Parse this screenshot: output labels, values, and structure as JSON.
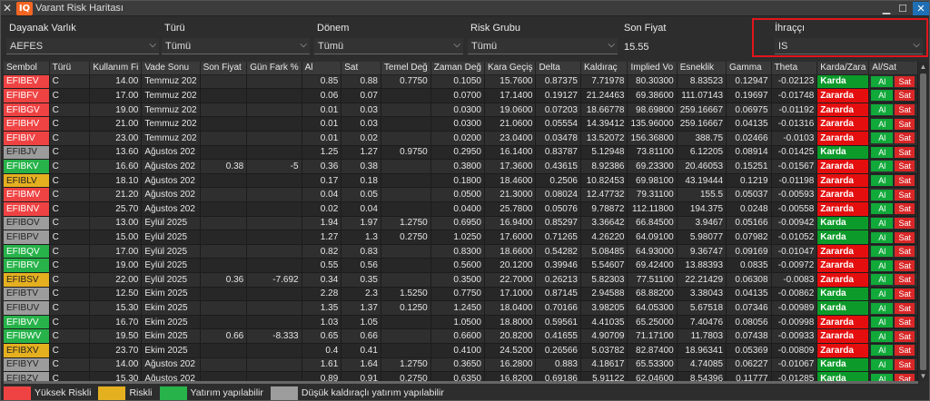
{
  "window": {
    "title": "Varant Risk Haritası",
    "logo": "IQ"
  },
  "filters": {
    "dayanak": {
      "label": "Dayanak Varlık",
      "value": "AEFES"
    },
    "turu": {
      "label": "Türü",
      "value": "Tümü"
    },
    "donem": {
      "label": "Dönem",
      "value": "Tümü"
    },
    "risk": {
      "label": "Risk Grubu",
      "value": "Tümü"
    },
    "sonfiyat": {
      "label": "Son Fiyat",
      "value": "15.55"
    },
    "ihracci": {
      "label": "İhraççı",
      "value": "IS"
    }
  },
  "columns": [
    "Sembol",
    "Türü",
    "Kullanım Fi",
    "Vade Sonu",
    "Son Fiyat",
    "Gün Fark %",
    "Al",
    "Sat",
    "Temel Değ",
    "Zaman Değ",
    "Kara Geçiş",
    "Delta",
    "Kaldıraç",
    "Implied Vo",
    "Esneklik",
    "Gamma",
    "Theta",
    "Karda/Zara",
    "Al/Sat"
  ],
  "buttons": {
    "al": "Al",
    "sat": "Sat"
  },
  "rows": [
    {
      "sym": "EFIBEV",
      "risk": "red",
      "t": "C",
      "k": "14.00",
      "v": "Temmuz 202",
      "sf": "",
      "gf": "",
      "al": "0.85",
      "sat": "0.88",
      "td": "0.7750",
      "zd": "0.1050",
      "kg": "15.7600",
      "d": "0.87375",
      "kl": "7.71978",
      "iv": "80.30300",
      "e": "8.83523",
      "g": "0.12947",
      "th": "-0.02123",
      "st": "Karda"
    },
    {
      "sym": "EFIBFV",
      "risk": "red",
      "t": "C",
      "k": "17.00",
      "v": "Temmuz 202",
      "sf": "",
      "gf": "",
      "al": "0.06",
      "sat": "0.07",
      "td": "",
      "zd": "0.0700",
      "kg": "17.1400",
      "d": "0.19127",
      "kl": "21.24463",
      "iv": "69.38600",
      "e": "111.07143",
      "g": "0.19697",
      "th": "-0.01748",
      "st": "Zararda"
    },
    {
      "sym": "EFIBGV",
      "risk": "red",
      "t": "C",
      "k": "19.00",
      "v": "Temmuz 202",
      "sf": "",
      "gf": "",
      "al": "0.01",
      "sat": "0.03",
      "td": "",
      "zd": "0.0300",
      "kg": "19.0600",
      "d": "0.07203",
      "kl": "18.66778",
      "iv": "98.69800",
      "e": "259.16667",
      "g": "0.06975",
      "th": "-0.01192",
      "st": "Zararda"
    },
    {
      "sym": "EFIBHV",
      "risk": "red",
      "t": "C",
      "k": "21.00",
      "v": "Temmuz 202",
      "sf": "",
      "gf": "",
      "al": "0.01",
      "sat": "0.03",
      "td": "",
      "zd": "0.0300",
      "kg": "21.0600",
      "d": "0.05554",
      "kl": "14.39412",
      "iv": "135.96000",
      "e": "259.16667",
      "g": "0.04135",
      "th": "-0.01316",
      "st": "Zararda"
    },
    {
      "sym": "EFIBIV",
      "risk": "red",
      "t": "C",
      "k": "23.00",
      "v": "Temmuz 202",
      "sf": "",
      "gf": "",
      "al": "0.01",
      "sat": "0.02",
      "td": "",
      "zd": "0.0200",
      "kg": "23.0400",
      "d": "0.03478",
      "kl": "13.52072",
      "iv": "156.36800",
      "e": "388.75",
      "g": "0.02466",
      "th": "-0.0103",
      "st": "Zararda"
    },
    {
      "sym": "EFIBJV",
      "risk": "gray",
      "t": "C",
      "k": "13.60",
      "v": "Ağustos 202",
      "sf": "",
      "gf": "",
      "al": "1.25",
      "sat": "1.27",
      "td": "0.9750",
      "zd": "0.2950",
      "kg": "16.1400",
      "d": "0.83787",
      "kl": "5.12948",
      "iv": "73.81100",
      "e": "6.12205",
      "g": "0.08914",
      "th": "-0.01425",
      "st": "Karda"
    },
    {
      "sym": "EFIBKV",
      "risk": "green",
      "t": "C",
      "k": "16.60",
      "v": "Ağustos 202",
      "sf": "0.38",
      "gf": "-5",
      "al": "0.36",
      "sat": "0.38",
      "td": "",
      "zd": "0.3800",
      "kg": "17.3600",
      "d": "0.43615",
      "kl": "8.92386",
      "iv": "69.23300",
      "e": "20.46053",
      "g": "0.15251",
      "th": "-0.01567",
      "st": "Zararda"
    },
    {
      "sym": "EFIBLV",
      "risk": "yellow",
      "t": "C",
      "k": "18.10",
      "v": "Ağustos 202",
      "sf": "",
      "gf": "",
      "al": "0.17",
      "sat": "0.18",
      "td": "",
      "zd": "0.1800",
      "kg": "18.4600",
      "d": "0.2506",
      "kl": "10.82453",
      "iv": "69.98100",
      "e": "43.19444",
      "g": "0.1219",
      "th": "-0.01198",
      "st": "Zararda"
    },
    {
      "sym": "EFIBMV",
      "risk": "red",
      "t": "C",
      "k": "21.20",
      "v": "Ağustos 202",
      "sf": "",
      "gf": "",
      "al": "0.04",
      "sat": "0.05",
      "td": "",
      "zd": "0.0500",
      "kg": "21.3000",
      "d": "0.08024",
      "kl": "12.47732",
      "iv": "79.31100",
      "e": "155.5",
      "g": "0.05037",
      "th": "-0.00593",
      "st": "Zararda"
    },
    {
      "sym": "EFIBNV",
      "risk": "red",
      "t": "C",
      "k": "25.70",
      "v": "Ağustos 202",
      "sf": "",
      "gf": "",
      "al": "0.02",
      "sat": "0.04",
      "td": "",
      "zd": "0.0400",
      "kg": "25.7800",
      "d": "0.05076",
      "kl": "9.78872",
      "iv": "112.11800",
      "e": "194.375",
      "g": "0.0248",
      "th": "-0.00558",
      "st": "Zararda"
    },
    {
      "sym": "EFIBOV",
      "risk": "gray",
      "t": "C",
      "k": "13.00",
      "v": "Eylül 2025",
      "sf": "",
      "gf": "",
      "al": "1.94",
      "sat": "1.97",
      "td": "1.2750",
      "zd": "0.6950",
      "kg": "16.9400",
      "d": "0.85297",
      "kl": "3.36642",
      "iv": "66.84500",
      "e": "3.9467",
      "g": "0.05166",
      "th": "-0.00942",
      "st": "Karda"
    },
    {
      "sym": "EFIBPV",
      "risk": "gray",
      "t": "C",
      "k": "15.00",
      "v": "Eylül 2025",
      "sf": "",
      "gf": "",
      "al": "1.27",
      "sat": "1.3",
      "td": "0.2750",
      "zd": "1.0250",
      "kg": "17.6000",
      "d": "0.71265",
      "kl": "4.26220",
      "iv": "64.09100",
      "e": "5.98077",
      "g": "0.07982",
      "th": "-0.01052",
      "st": "Karda"
    },
    {
      "sym": "EFIBQV",
      "risk": "green",
      "t": "C",
      "k": "17.00",
      "v": "Eylül 2025",
      "sf": "",
      "gf": "",
      "al": "0.82",
      "sat": "0.83",
      "td": "",
      "zd": "0.8300",
      "kg": "18.6600",
      "d": "0.54282",
      "kl": "5.08485",
      "iv": "64.93000",
      "e": "9.36747",
      "g": "0.09169",
      "th": "-0.01047",
      "st": "Zararda"
    },
    {
      "sym": "EFIBRV",
      "risk": "green",
      "t": "C",
      "k": "19.00",
      "v": "Eylül 2025",
      "sf": "",
      "gf": "",
      "al": "0.55",
      "sat": "0.56",
      "td": "",
      "zd": "0.5600",
      "kg": "20.1200",
      "d": "0.39946",
      "kl": "5.54607",
      "iv": "69.42400",
      "e": "13.88393",
      "g": "0.0835",
      "th": "-0.00972",
      "st": "Zararda"
    },
    {
      "sym": "EFIBSV",
      "risk": "yellow",
      "t": "C",
      "k": "22.00",
      "v": "Eylül 2025",
      "sf": "0.36",
      "gf": "-7.692",
      "al": "0.34",
      "sat": "0.35",
      "td": "",
      "zd": "0.3500",
      "kg": "22.7000",
      "d": "0.26213",
      "kl": "5.82303",
      "iv": "77.51100",
      "e": "22.21429",
      "g": "0.06308",
      "th": "-0.0083",
      "st": "Zararda"
    },
    {
      "sym": "EFIBTV",
      "risk": "gray",
      "t": "C",
      "k": "12.50",
      "v": "Ekim 2025",
      "sf": "",
      "gf": "",
      "al": "2.28",
      "sat": "2.3",
      "td": "1.5250",
      "zd": "0.7750",
      "kg": "17.1000",
      "d": "0.87145",
      "kl": "2.94588",
      "iv": "68.88200",
      "e": "3.38043",
      "g": "0.04135",
      "th": "-0.00862",
      "st": "Karda"
    },
    {
      "sym": "EFIBUV",
      "risk": "gray",
      "t": "C",
      "k": "15.30",
      "v": "Ekim 2025",
      "sf": "",
      "gf": "",
      "al": "1.35",
      "sat": "1.37",
      "td": "0.1250",
      "zd": "1.2450",
      "kg": "18.0400",
      "d": "0.70166",
      "kl": "3.98205",
      "iv": "64.05300",
      "e": "5.67518",
      "g": "0.07346",
      "th": "-0.00989",
      "st": "Karda"
    },
    {
      "sym": "EFIBVV",
      "risk": "green",
      "t": "C",
      "k": "16.70",
      "v": "Ekim 2025",
      "sf": "",
      "gf": "",
      "al": "1.03",
      "sat": "1.05",
      "td": "",
      "zd": "1.0500",
      "kg": "18.8000",
      "d": "0.59561",
      "kl": "4.41035",
      "iv": "65.25000",
      "e": "7.40476",
      "g": "0.08056",
      "th": "-0.00998",
      "st": "Zararda"
    },
    {
      "sym": "EFIBWV",
      "risk": "green",
      "t": "C",
      "k": "19.50",
      "v": "Ekim 2025",
      "sf": "0.66",
      "gf": "-8.333",
      "al": "0.65",
      "sat": "0.66",
      "td": "",
      "zd": "0.6600",
      "kg": "20.8200",
      "d": "0.41655",
      "kl": "4.90709",
      "iv": "71.17100",
      "e": "11.7803",
      "g": "0.07438",
      "th": "-0.00933",
      "st": "Zararda"
    },
    {
      "sym": "EFIBXV",
      "risk": "yellow",
      "t": "C",
      "k": "23.70",
      "v": "Ekim 2025",
      "sf": "",
      "gf": "",
      "al": "0.4",
      "sat": "0.41",
      "td": "",
      "zd": "0.4100",
      "kg": "24.5200",
      "d": "0.26566",
      "kl": "5.03782",
      "iv": "82.87400",
      "e": "18.96341",
      "g": "0.05369",
      "th": "-0.00809",
      "st": "Zararda"
    },
    {
      "sym": "EFIBYV",
      "risk": "gray",
      "t": "C",
      "k": "14.00",
      "v": "Ağustos 202",
      "sf": "",
      "gf": "",
      "al": "1.61",
      "sat": "1.64",
      "td": "1.2750",
      "zd": "0.3650",
      "kg": "16.2800",
      "d": "0.883",
      "kl": "4.18617",
      "iv": "65.53300",
      "e": "4.74085",
      "g": "0.06227",
      "th": "-0.01067",
      "st": "Karda"
    },
    {
      "sym": "EFIBZV",
      "risk": "gray",
      "t": "C",
      "k": "15.30",
      "v": "Ağustos 202",
      "sf": "",
      "gf": "",
      "al": "0.89",
      "sat": "0.91",
      "td": "0.2750",
      "zd": "0.6350",
      "kg": "16.8200",
      "d": "0.69186",
      "kl": "5.91122",
      "iv": "62.04600",
      "e": "8.54396",
      "g": "0.11777",
      "th": "-0.01285",
      "st": "Karda"
    }
  ],
  "legend": [
    {
      "label": "Yüksek Riskli",
      "color": "#ef4343"
    },
    {
      "label": "Riskli",
      "color": "#e5b020"
    },
    {
      "label": "Yatırım yapılabilir",
      "color": "#27b34a"
    },
    {
      "label": "Düşük kaldıraçlı yatırım yapılabilir",
      "color": "#9c9c9c"
    }
  ]
}
